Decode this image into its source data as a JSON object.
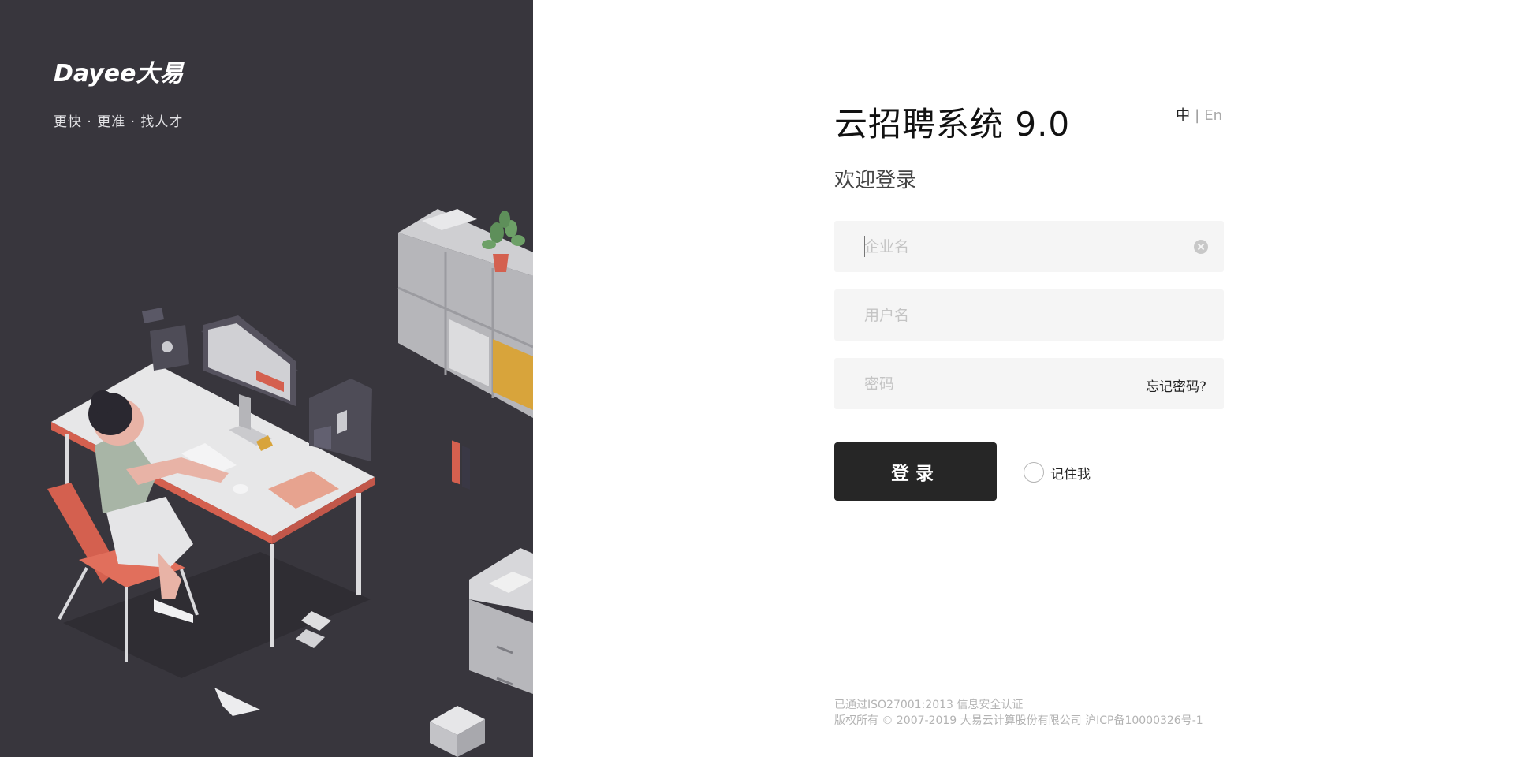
{
  "brand": {
    "logo_text": "Dayee大易",
    "slogan": "更快 · 更准 · 找人才"
  },
  "login": {
    "title": "云招聘系统 9.0",
    "lang_zh": "中",
    "lang_sep": "|",
    "lang_en": "En",
    "welcome": "欢迎登录",
    "company_placeholder": "企业名",
    "username_placeholder": "用户名",
    "password_placeholder": "密码",
    "forgot_password": "忘记密码?",
    "submit_label": "登录",
    "remember_me": "记住我"
  },
  "footer": {
    "line1": "已通过ISO27001:2013 信息安全认证",
    "line2": "版权所有 © 2007-2019 大易云计算股份有限公司 沪ICP备10000326号-1"
  },
  "colors": {
    "left_panel_bg": "#38363d",
    "button_bg": "#262626",
    "input_bg": "#f5f5f5"
  }
}
